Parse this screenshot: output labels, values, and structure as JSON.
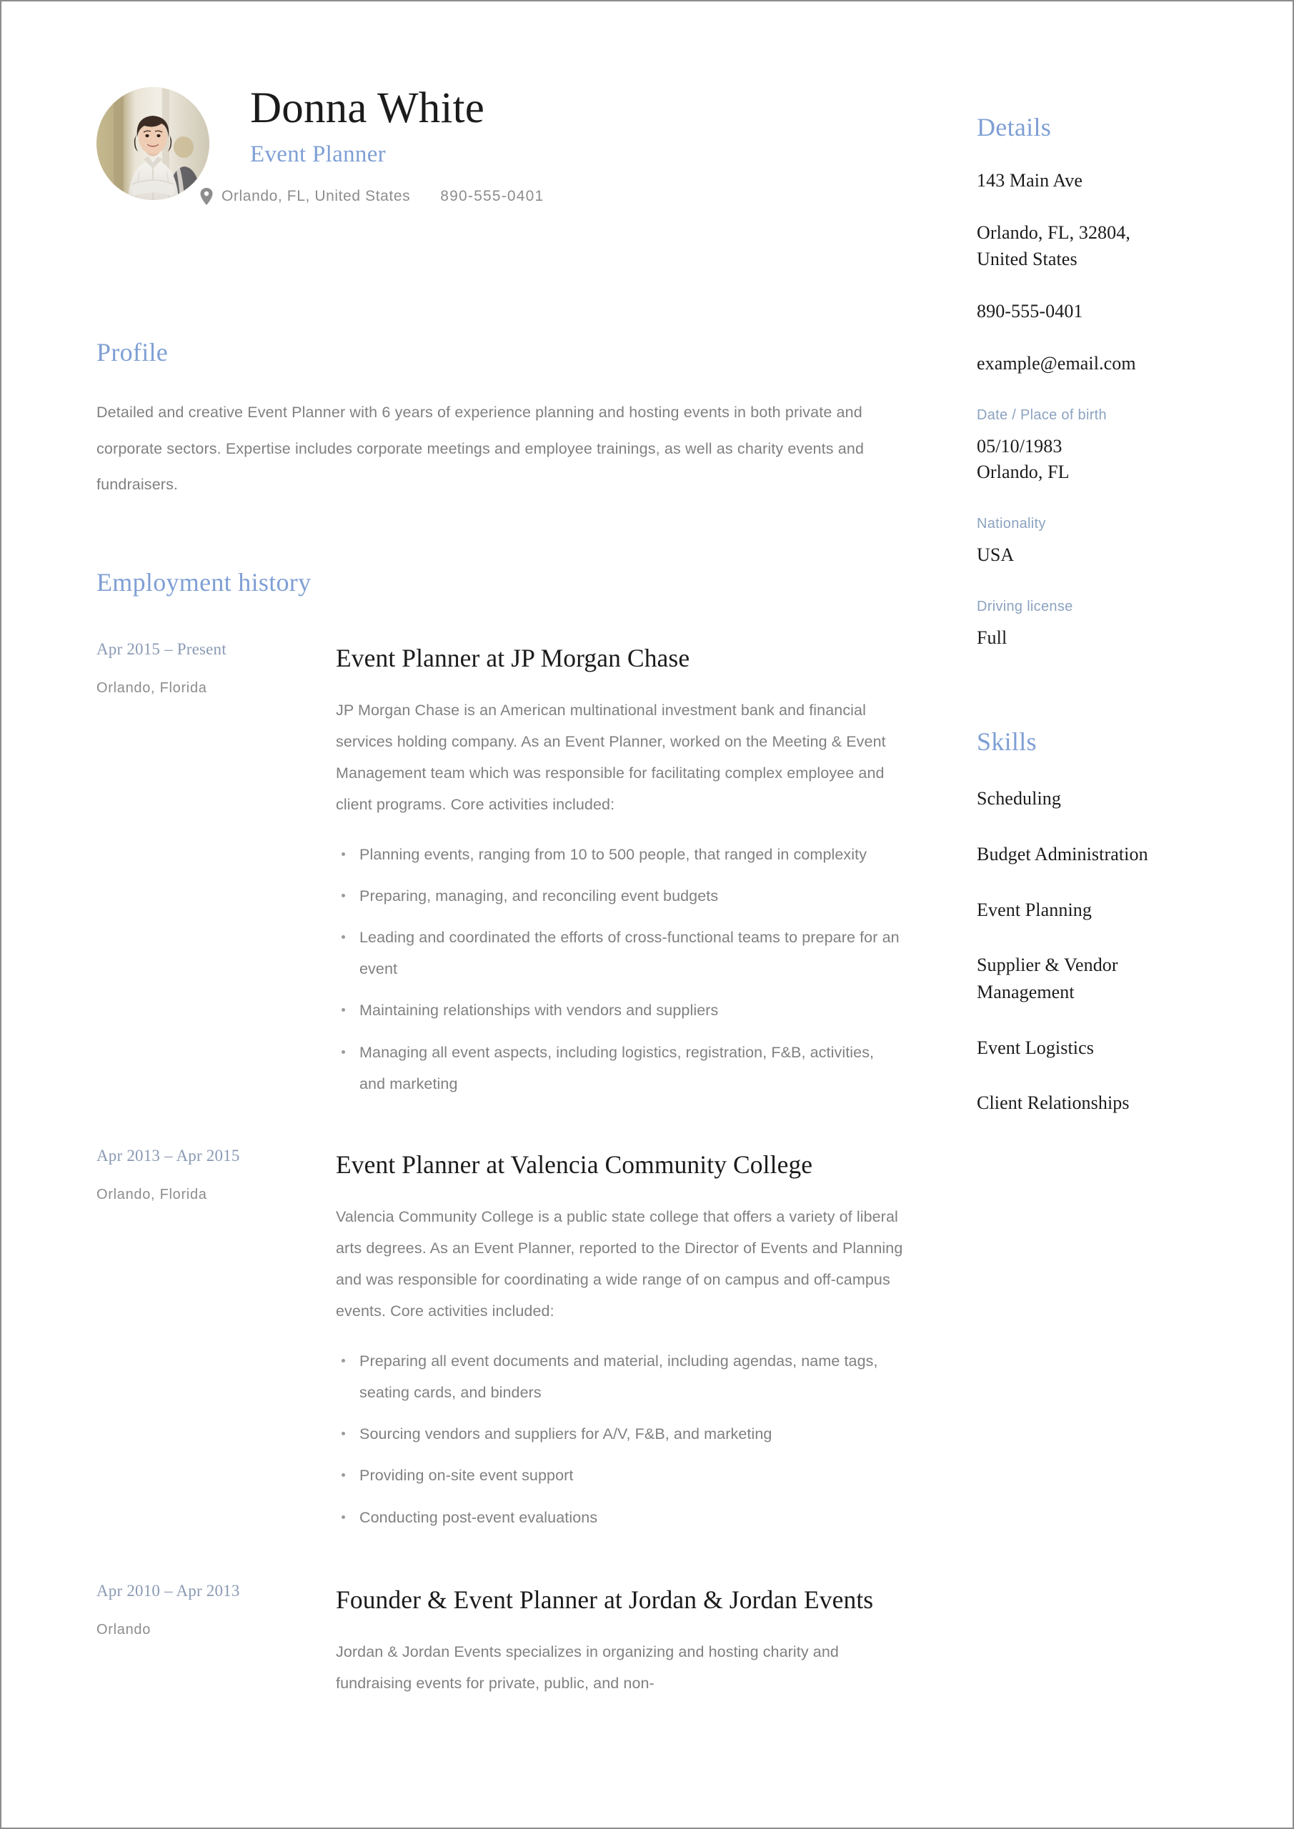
{
  "theme": {
    "accent_blue": "#7f9fd4",
    "muted_blue": "#8a9ab4",
    "label_blue": "#8ca3c0",
    "body_gray": "#808080",
    "heading_black": "#1b1b1b",
    "page_border": "#8c8c8c"
  },
  "header": {
    "name": "Donna White",
    "job_title": "Event Planner",
    "location": "Orlando, FL, United States",
    "phone": "890-555-0401",
    "avatar_alt": "Portrait of Donna White",
    "location_icon": "map-pin-icon"
  },
  "profile": {
    "heading": "Profile",
    "body": "Detailed and creative Event Planner with 6 years of experience planning and hosting events in both private and corporate sectors. Expertise includes corporate meetings and employee trainings, as well as charity events and fundraisers."
  },
  "employment": {
    "heading": "Employment history",
    "jobs": [
      {
        "dates": "Apr 2015 – Present",
        "location": "Orlando, Florida",
        "title": "Event Planner at JP Morgan Chase",
        "description": "JP Morgan Chase is an American multinational investment bank and financial services holding company. As an Event Planner, worked on the Meeting & Event Management team which was responsible for facilitating complex employee and client programs. Core activities included:",
        "bullets": [
          "Planning events, ranging from 10 to 500 people, that ranged in complexity",
          "Preparing, managing, and reconciling event budgets",
          "Leading and coordinated the efforts of cross-functional teams to prepare for an event",
          "Maintaining relationships with vendors and suppliers",
          "Managing all event aspects, including logistics, registration, F&B, activities, and marketing"
        ]
      },
      {
        "dates": "Apr 2013 – Apr 2015",
        "location": "Orlando, Florida",
        "title": "Event Planner at Valencia Community College",
        "description": "Valencia Community College is a public state college that offers a variety of liberal arts degrees. As an Event Planner, reported to the Director of Events and Planning and was responsible for coordinating a wide range of on campus and off-campus events. Core activities included:",
        "bullets": [
          "Preparing all event documents and material, including agendas, name tags, seating cards, and binders",
          "Sourcing vendors and suppliers for A/V, F&B, and marketing",
          "Providing on-site event support",
          "Conducting post-event evaluations"
        ]
      },
      {
        "dates": "Apr 2010 – Apr 2013",
        "location": "Orlando",
        "title": "Founder & Event Planner at Jordan & Jordan Events",
        "description": "Jordan & Jordan Events specializes in organizing and hosting charity and fundraising events for private, public, and non-",
        "bullets": []
      }
    ]
  },
  "details": {
    "heading": "Details",
    "address_street": "143 Main Ave",
    "address_city": "Orlando, FL, 32804,\nUnited States",
    "address_city_line1": "Orlando, FL, 32804,",
    "address_city_line2": "United States",
    "phone": "890-555-0401",
    "email": "example@email.com",
    "birth_label": "Date / Place of birth",
    "birth_date": "05/10/1983",
    "birth_place": "Orlando, FL",
    "nationality_label": "Nationality",
    "nationality_value": "USA",
    "license_label": "Driving license",
    "license_value": "Full"
  },
  "skills": {
    "heading": "Skills",
    "items": [
      "Scheduling",
      "Budget Administration",
      "Event Planning",
      "Supplier & Vendor Management",
      "Event Logistics",
      "Client Relationships"
    ]
  }
}
